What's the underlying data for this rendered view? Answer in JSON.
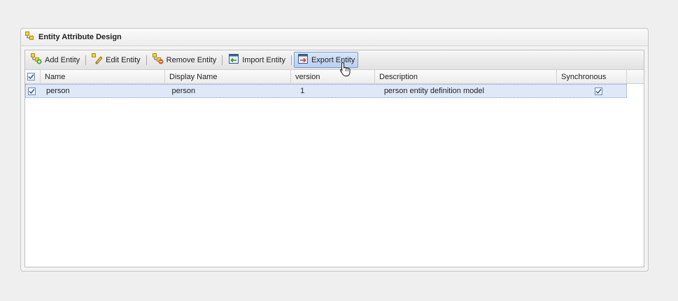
{
  "panel": {
    "title": "Entity Attribute Design"
  },
  "toolbar": {
    "buttons": [
      {
        "label": "Add Entity",
        "icon": "add-entity-icon"
      },
      {
        "label": "Edit Entity",
        "icon": "edit-entity-icon"
      },
      {
        "label": "Remove Entity",
        "icon": "remove-entity-icon"
      },
      {
        "label": "Import Entity",
        "icon": "import-entity-icon"
      },
      {
        "label": "Export Entity",
        "icon": "export-entity-icon",
        "active": true
      }
    ]
  },
  "grid": {
    "columns": [
      "Name",
      "Display Name",
      "version",
      "Description",
      "Synchronous"
    ],
    "header_checked": true,
    "rows": [
      {
        "checked": true,
        "name": "person",
        "display_name": "person",
        "version": "1",
        "description": "person entity definition model",
        "synchronous": true
      }
    ]
  },
  "colors": {
    "selected_row": "#dfe8f6",
    "active_button": "#b7cff0",
    "background": "#efefef"
  }
}
